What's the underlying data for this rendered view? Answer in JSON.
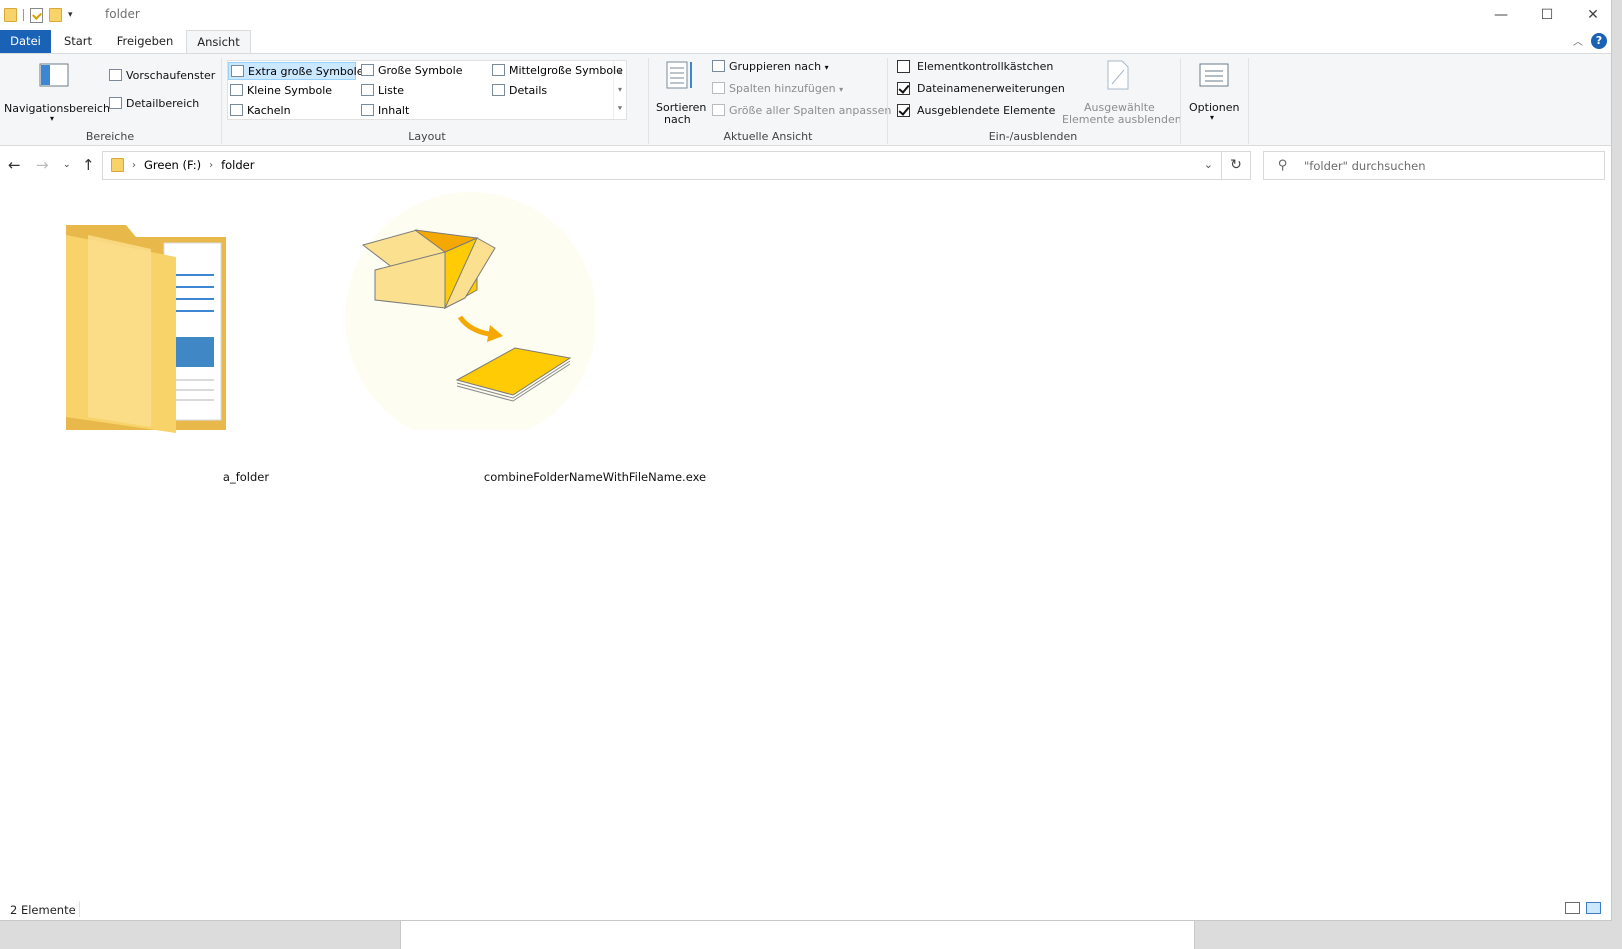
{
  "titlebar": {
    "title": "folder",
    "minimize": "—",
    "maximize": "☐",
    "close": "✕"
  },
  "tabs": {
    "file": "Datei",
    "start": "Start",
    "share": "Freigeben",
    "view": "Ansicht",
    "help": "?"
  },
  "ribbon": {
    "bereiche": {
      "label": "Bereiche",
      "nav_pane": "Navigationsbereich",
      "preview_pane": "Vorschaufenster",
      "details_pane": "Detailbereich"
    },
    "layout": {
      "label": "Layout",
      "items": [
        "Extra große Symbole",
        "Große Symbole",
        "Mittelgroße Symbole",
        "Kleine Symbole",
        "Liste",
        "Details",
        "Kacheln",
        "Inhalt"
      ],
      "selected": "Extra große Symbole"
    },
    "current_view": {
      "label": "Aktuelle Ansicht",
      "sort_line1": "Sortieren",
      "sort_line2": "nach",
      "group_by": "Gruppieren nach",
      "add_columns": "Spalten hinzufügen",
      "fit_columns": "Größe aller Spalten anpassen"
    },
    "show_hide": {
      "label": "Ein-/ausblenden",
      "item_checkboxes": {
        "label": "Elementkontrollkästchen",
        "checked": false
      },
      "file_extensions": {
        "label": "Dateinamenerweiterungen",
        "checked": true
      },
      "hidden_items": {
        "label": "Ausgeblendete Elemente",
        "checked": true
      },
      "hide_selected_line1": "Ausgewählte",
      "hide_selected_line2": "Elemente ausblenden"
    },
    "options": "Optionen"
  },
  "address": {
    "crumbs": [
      "Green (F:)",
      "folder"
    ],
    "search_placeholder": "\"folder\" durchsuchen"
  },
  "items": [
    {
      "name": "a_folder",
      "type": "folder"
    },
    {
      "name": "combineFolderNameWithFileName.exe",
      "type": "exe"
    }
  ],
  "status": {
    "count": "2 Elemente"
  },
  "colors": {
    "accent": "#1a62b5",
    "folder": "#f7d36a",
    "package": "#ffcb05",
    "selected": "#cce8ff"
  }
}
